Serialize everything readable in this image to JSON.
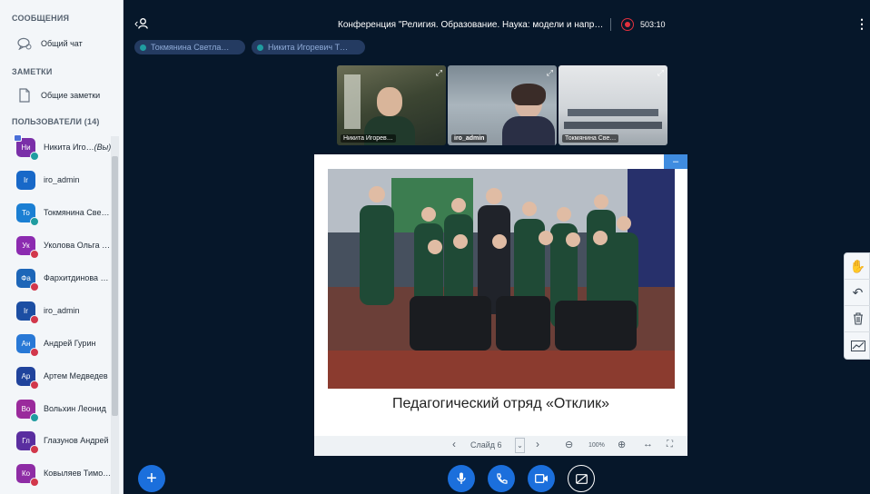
{
  "sidebar": {
    "messages_title": "СООБЩЕНИЯ",
    "public_chat": "Общий чат",
    "notes_title": "ЗАМЕТКИ",
    "shared_notes": "Общие заметки",
    "users_title": "ПОЛЬЗОВАТЕЛИ (14)",
    "users": [
      {
        "initials": "Ни",
        "name": "Никита Иго…",
        "you": "(Вы)",
        "color": "#7a2fa8",
        "status_color": "#1f9ca0",
        "presenter": true
      },
      {
        "initials": "Ir",
        "name": "iro_admin",
        "color": "#1868c8",
        "status_color": "",
        "presenter": false
      },
      {
        "initials": "То",
        "name": "Токмянина Све…",
        "color": "#1b7fd3",
        "status_color": "#1f9ca0",
        "presenter": false
      },
      {
        "initials": "Ук",
        "name": "Уколова Ольга …",
        "color": "#8c2bb0",
        "status_color": "#d2374b",
        "presenter": false
      },
      {
        "initials": "Фа",
        "name": "Фархитдинова …",
        "color": "#1d66b8",
        "status_color": "#d2374b",
        "presenter": false
      },
      {
        "initials": "Ir",
        "name": "iro_admin",
        "color": "#1c4ea3",
        "status_color": "#d2374b",
        "presenter": false
      },
      {
        "initials": "Ан",
        "name": "Андрей Гурин",
        "color": "#2878d6",
        "status_color": "#d2374b",
        "presenter": false
      },
      {
        "initials": "Ар",
        "name": "Артем Медведев",
        "color": "#20439c",
        "status_color": "#d2374b",
        "presenter": false
      },
      {
        "initials": "Во",
        "name": "Вольхин Леонид",
        "color": "#9a2a9c",
        "status_color": "#1f9ca0",
        "presenter": false
      },
      {
        "initials": "Гл",
        "name": "Глазунов Андрей",
        "color": "#5a2ea0",
        "status_color": "#d2374b",
        "presenter": false
      },
      {
        "initials": "Ко",
        "name": "Ковыляев Тимо…",
        "color": "#8e2ca5",
        "status_color": "#d2374b",
        "presenter": false
      }
    ]
  },
  "topbar": {
    "title": "Конференция \"Религия. Образование. Наука: модели и напр…",
    "recording_time": "503:10"
  },
  "talkers": [
    {
      "name": "Токмянина Светла…",
      "dot_color": "#1f9ca0"
    },
    {
      "name": "Никита Игоревич Т…",
      "dot_color": "#1f9ca0"
    }
  ],
  "cameras": [
    {
      "label": "Никита Игорев…"
    },
    {
      "label": "iro_admin"
    },
    {
      "label": "Токмянина Све…"
    }
  ],
  "presentation": {
    "caption": "Педагогический отряд «Отклик»",
    "slide_label": "Слайд 6",
    "zoom": "100%"
  },
  "icons": {
    "users_toggle": "user-icon",
    "chat": "chat-icon",
    "notes": "document-icon",
    "hand": "hand-icon",
    "undo": "undo-icon",
    "trash": "trash-icon",
    "chart": "chart-icon",
    "mic": "microphone-icon",
    "phone": "phone-icon",
    "camera": "camera-icon",
    "screen": "screen-share-icon",
    "plus": "plus-icon"
  },
  "colors": {
    "accent": "#1b6fdc",
    "recording": "#e2303d",
    "background": "#06172a"
  }
}
